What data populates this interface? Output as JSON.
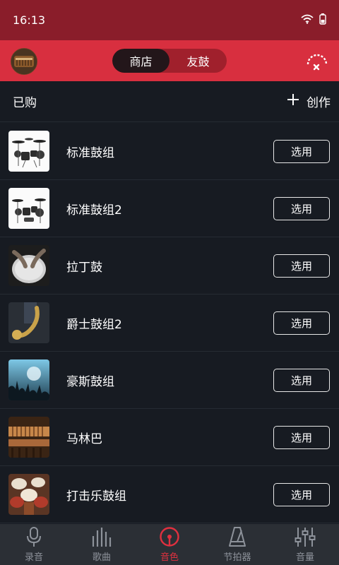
{
  "status_bar": {
    "time": "16:13"
  },
  "header": {
    "tabs": [
      {
        "label": "商店",
        "active": true
      },
      {
        "label": "友鼓",
        "active": false
      }
    ]
  },
  "subbar": {
    "title": "已购",
    "create_label": "创作"
  },
  "items": [
    {
      "name": "标准鼓组",
      "button": "选用"
    },
    {
      "name": "标准鼓组2",
      "button": "选用"
    },
    {
      "name": "拉丁鼓",
      "button": "选用"
    },
    {
      "name": "爵士鼓组2",
      "button": "选用"
    },
    {
      "name": "豪斯鼓组",
      "button": "选用"
    },
    {
      "name": "马林巴",
      "button": "选用"
    },
    {
      "name": "打击乐鼓组",
      "button": "选用"
    }
  ],
  "bottom_nav": [
    {
      "label": "录音",
      "icon": "microphone-icon",
      "active": false
    },
    {
      "label": "歌曲",
      "icon": "equalizer-bars-icon",
      "active": false
    },
    {
      "label": "音色",
      "icon": "tone-dial-icon",
      "active": true
    },
    {
      "label": "节拍器",
      "icon": "metronome-icon",
      "active": false
    },
    {
      "label": "音量",
      "icon": "mixer-sliders-icon",
      "active": false
    }
  ],
  "colors": {
    "accent": "#d82f3f",
    "status_bar": "#8a1d2a",
    "background": "#171b22",
    "nav_bg": "#2b2f35"
  }
}
